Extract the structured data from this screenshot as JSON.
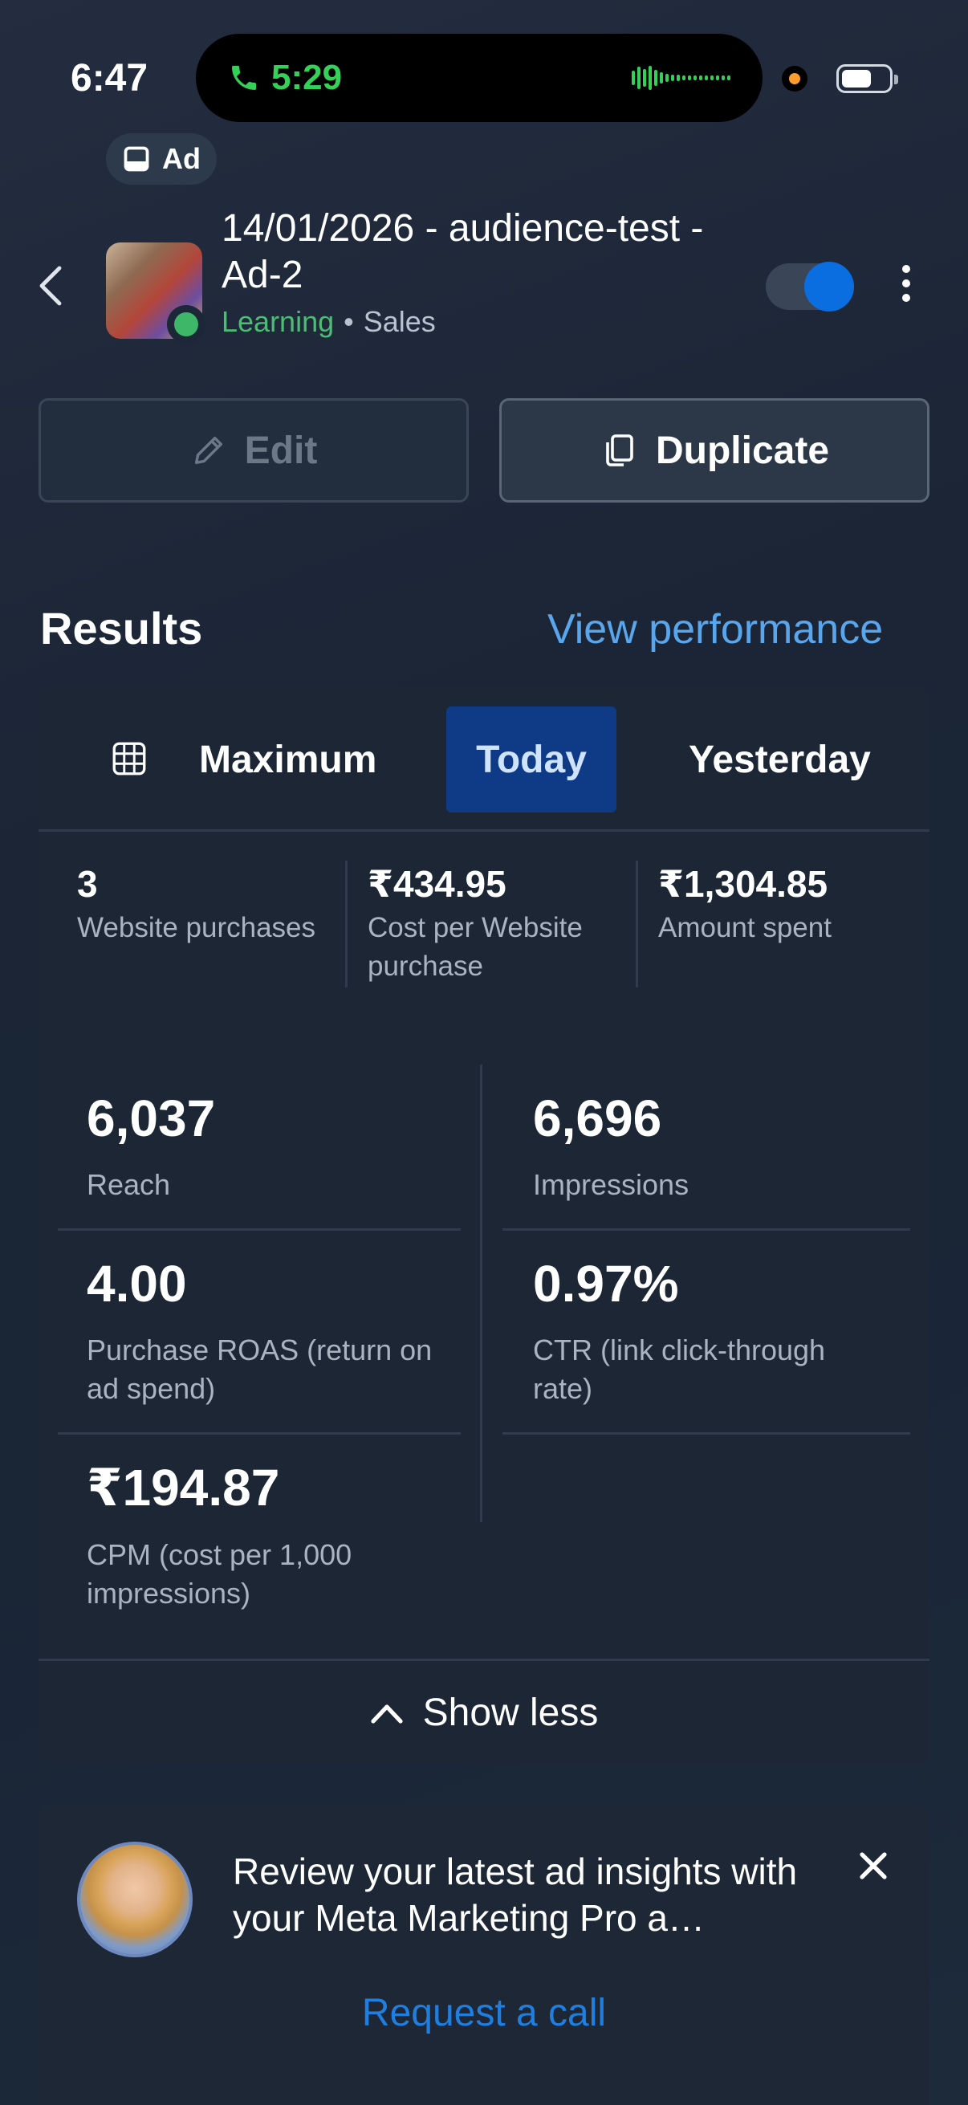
{
  "status_bar": {
    "time": "6:47",
    "call_time": "5:29"
  },
  "header": {
    "badge_label": "Ad",
    "title": "14/01/2026 - audience-test - Ad-2",
    "status": "Learning",
    "separator": "•",
    "objective": "Sales",
    "toggle_on": true
  },
  "actions": {
    "edit_label": "Edit",
    "duplicate_label": "Duplicate"
  },
  "results": {
    "title": "Results",
    "view_performance": "View performance",
    "tabs": [
      {
        "label": "Maximum",
        "active": false
      },
      {
        "label": "Today",
        "active": true
      },
      {
        "label": "Yesterday",
        "active": false
      }
    ],
    "kpis": [
      {
        "value": "3",
        "label": "Website purchases"
      },
      {
        "value": "₹434.95",
        "label": "Cost per Website purchase"
      },
      {
        "value": "₹1,304.85",
        "label": "Amount spent"
      }
    ],
    "metrics": [
      {
        "value": "6,037",
        "label": "Reach"
      },
      {
        "value": "6,696",
        "label": "Impressions"
      },
      {
        "value": "4.00",
        "label": "Purchase ROAS (return on ad spend)"
      },
      {
        "value": "0.97%",
        "label": "CTR (link click-through rate)"
      },
      {
        "value": "₹194.87",
        "label": "CPM (cost per 1,000 impressions)"
      }
    ],
    "show_less": "Show less"
  },
  "insights": {
    "text": "Review your latest ad insights with your Meta Marketing Pro a…",
    "cta": "Request a call"
  },
  "colors": {
    "accent": "#1f7fe0",
    "learning": "#4dbd74",
    "active_tab": "#0e3a86",
    "call_green": "#34d058"
  }
}
